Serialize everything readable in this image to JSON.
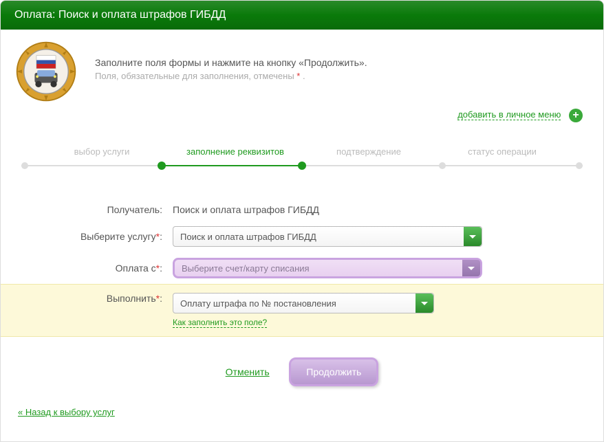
{
  "header": {
    "title": "Оплата: Поиск и оплата штрафов ГИБДД"
  },
  "instructions": {
    "line1": "Заполните поля формы и нажмите на кнопку «Продолжить».",
    "line2_prefix": "Поля, обязательные для заполнения, отмечены ",
    "line2_suffix": " ."
  },
  "add_menu": {
    "label": "добавить в личное меню"
  },
  "steps": {
    "items": [
      {
        "label": "выбор услуги"
      },
      {
        "label": "заполнение реквизитов",
        "active": true
      },
      {
        "label": "подтверждение"
      },
      {
        "label": "статус операции"
      }
    ]
  },
  "form": {
    "recipient_label": "Получатель:",
    "recipient_value": "Поиск и оплата штрафов ГИБДД",
    "service_label": "Выберите услугу",
    "service_value": "Поиск и оплата штрафов ГИБДД",
    "payment_label": "Оплата с",
    "payment_placeholder": "Выберите счет/карту списания",
    "action_label": "Выполнить",
    "action_value": "Оплату штрафа по № постановления",
    "help_link": "Как заполнить это поле?"
  },
  "actions": {
    "cancel": "Отменить",
    "continue": "Продолжить"
  },
  "back_link": "« Назад к выбору услуг"
}
